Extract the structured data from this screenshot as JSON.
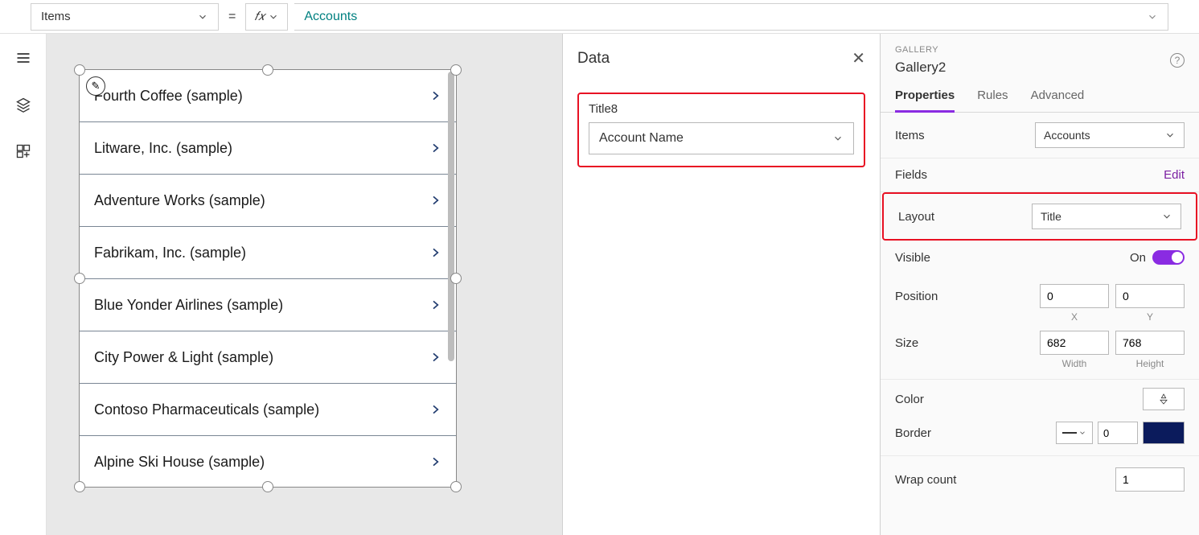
{
  "formula": {
    "property_label": "Items",
    "expression": "Accounts"
  },
  "gallery": {
    "items": [
      "Fourth Coffee (sample)",
      "Litware, Inc. (sample)",
      "Adventure Works (sample)",
      "Fabrikam, Inc. (sample)",
      "Blue Yonder Airlines (sample)",
      "City Power & Light (sample)",
      "Contoso Pharmaceuticals (sample)",
      "Alpine Ski House (sample)"
    ]
  },
  "data_panel": {
    "title": "Data",
    "field_label": "Title8",
    "field_value": "Account Name"
  },
  "props": {
    "type": "GALLERY",
    "name": "Gallery2",
    "tabs": {
      "t0": "Properties",
      "t1": "Rules",
      "t2": "Advanced"
    },
    "items_label": "Items",
    "items_value": "Accounts",
    "fields_label": "Fields",
    "fields_edit": "Edit",
    "layout_label": "Layout",
    "layout_value": "Title",
    "visible_label": "Visible",
    "visible_state": "On",
    "position_label": "Position",
    "position_x": "0",
    "position_y": "0",
    "position_xl": "X",
    "position_yl": "Y",
    "size_label": "Size",
    "size_w": "682",
    "size_h": "768",
    "size_wl": "Width",
    "size_hl": "Height",
    "color_label": "Color",
    "border_label": "Border",
    "border_width": "0",
    "wrap_label": "Wrap count",
    "wrap_value": "1"
  }
}
